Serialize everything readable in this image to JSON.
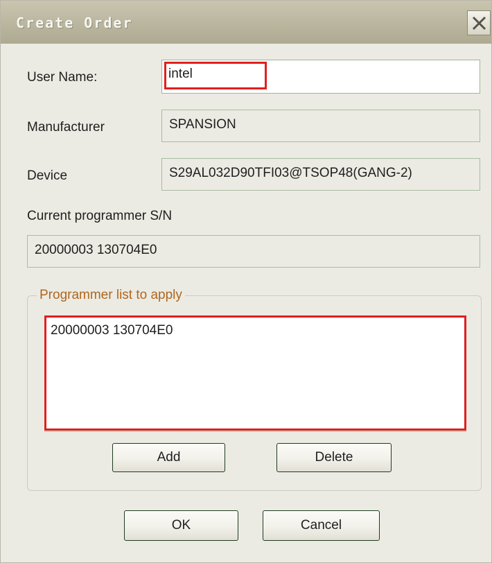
{
  "window": {
    "title": "Create Order",
    "close_icon": "close-icon"
  },
  "form": {
    "user_name_label": "User Name:",
    "user_name_value": "intel",
    "manufacturer_label": "Manufacturer",
    "manufacturer_value": "SPANSION",
    "device_label": "Device",
    "device_value": "S29AL032D90TFI03@TSOP48(GANG-2)",
    "current_sn_label": "Current programmer S/N",
    "current_sn_value": "20000003 130704E0"
  },
  "programmer_list": {
    "legend": "Programmer list to apply",
    "items": [
      "20000003 130704E0"
    ],
    "add_label": "Add",
    "delete_label": "Delete"
  },
  "footer": {
    "ok_label": "OK",
    "cancel_label": "Cancel"
  },
  "colors": {
    "highlight": "#e21e1e",
    "legend_text": "#b0661e",
    "dialog_bg": "#ecebe3"
  }
}
